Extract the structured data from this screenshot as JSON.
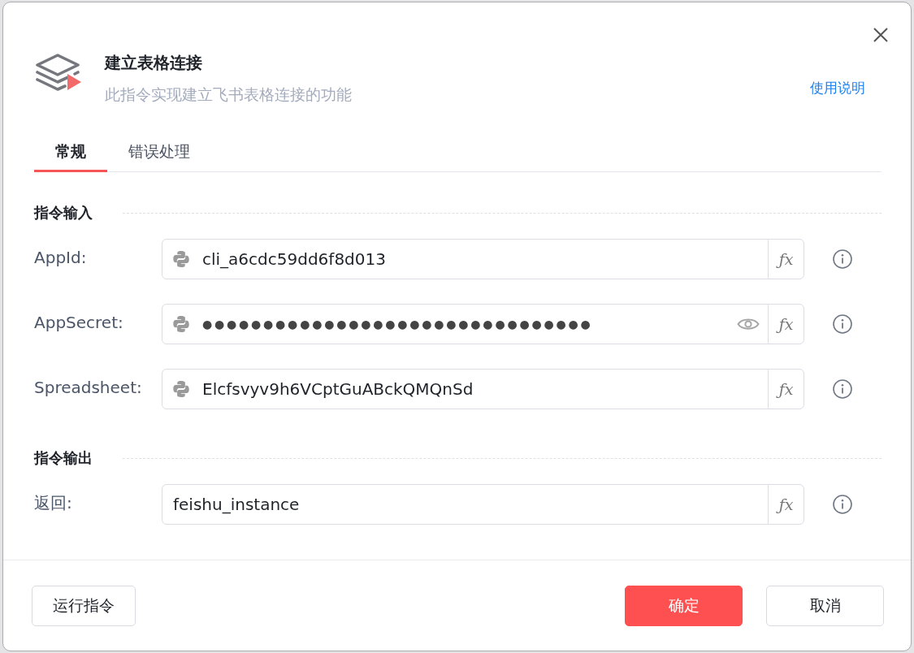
{
  "dialog": {
    "title": "建立表格连接",
    "subtitle": "此指令实现建立飞书表格连接的功能",
    "help_link": "使用说明"
  },
  "tabs": [
    {
      "label": "常规",
      "selected": true
    },
    {
      "label": "错误处理",
      "selected": false
    }
  ],
  "sections": [
    {
      "title": "指令输入",
      "fields": [
        {
          "label": "AppId:",
          "kind": "python",
          "value": "cli_a6cdc59dd6f8d013",
          "masked": false,
          "formula_button": "ƒx"
        },
        {
          "label": "AppSecret:",
          "kind": "python",
          "value": "●●●●●●●●●●●●●●●●●●●●●●●●●●●●●●●●",
          "masked": true,
          "formula_button": "ƒx"
        },
        {
          "label": "Spreadsheet:",
          "kind": "python",
          "value": "Elcfsvyv9h6VCptGuABckQMQnSd",
          "masked": false,
          "formula_button": "ƒx"
        }
      ]
    },
    {
      "title": "指令输出",
      "fields": [
        {
          "label": "返回:",
          "kind": "plain",
          "value": "feishu_instance",
          "masked": false,
          "formula_button": "ƒx"
        }
      ]
    }
  ],
  "footer": {
    "left_buttons": [
      {
        "label": "运行指令",
        "kind": "default"
      }
    ],
    "right_buttons": [
      {
        "label": "确定",
        "kind": "primary"
      },
      {
        "label": "取消",
        "kind": "default"
      }
    ]
  }
}
